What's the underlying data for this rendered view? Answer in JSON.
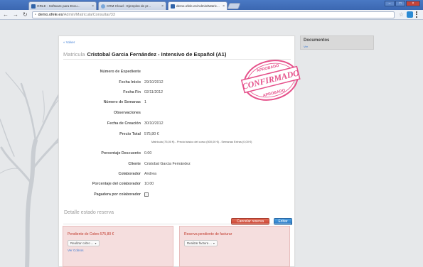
{
  "browser": {
    "tabs": [
      {
        "label": "ORLE - Software para Escu..."
      },
      {
        "label": "CRM Cloud - Ejemplos de pr..."
      },
      {
        "label": "demo.ofele.es/Admin/Matric..."
      }
    ],
    "address": {
      "domain": "demo.ofele.es",
      "path": "/Admin/Matricula/Consultar/33"
    }
  },
  "page": {
    "back_link": "« Volver",
    "title_label": "Matricula",
    "title_name": "Cristobal Garcia Fernández - Intensivo de Español (A1)",
    "stamp": {
      "top": "APROBADO",
      "main": "CONFIRMADO",
      "bottom": "APROBADO",
      "color": "#e5508a"
    },
    "fields": {
      "expediente": {
        "label": "Número de Expediente",
        "value": ""
      },
      "inicio": {
        "label": "Fecha Inicio",
        "value": "29/10/2012"
      },
      "fin": {
        "label": "Fecha Fin",
        "value": "02/11/2012"
      },
      "semanas": {
        "label": "Número de Semanas",
        "value": "1"
      },
      "observaciones": {
        "label": "Observaciones",
        "value": ""
      },
      "creacion": {
        "label": "Fecha de Creación",
        "value": "30/10/2012"
      },
      "precio": {
        "label": "Precio Total",
        "value": "575,80 €"
      },
      "descuento": {
        "label": "Porcentaje Descuento",
        "value": "0.00"
      },
      "cliente": {
        "label": "Cliente",
        "value": "Cristobal Garcia Fernández"
      },
      "colaborador": {
        "label": "Colaborador",
        "value": "Andrea"
      },
      "pct_colaborador": {
        "label": "Porcentaje del colaborador",
        "value": "10.00"
      },
      "pagadera": {
        "label": "Pagadera por colaborador",
        "checked": false
      }
    },
    "price_note": "Matricula (75,00 €) - Precio básico del curso (500,00 €) - Semanas Extras (0,00 €)",
    "buttons": {
      "cancel": "Cancelar reserva",
      "edit": "Editar"
    },
    "status_title": "Detalle estado reserva",
    "box_left": {
      "title": "Pendiente de Cobro 575,80 €",
      "select": "Realizar cobro ...",
      "link": "Ver Cobros"
    },
    "box_right": {
      "title": "Reserva pendiente de facturar",
      "select": "Realizar factura ..."
    }
  },
  "sidebar": {
    "title": "Documentos",
    "link": "Ver"
  },
  "colors": {
    "danger": "#c8402f",
    "primary": "#2a76c2",
    "link": "#3a7bd5",
    "box_bg": "#f5dede"
  }
}
